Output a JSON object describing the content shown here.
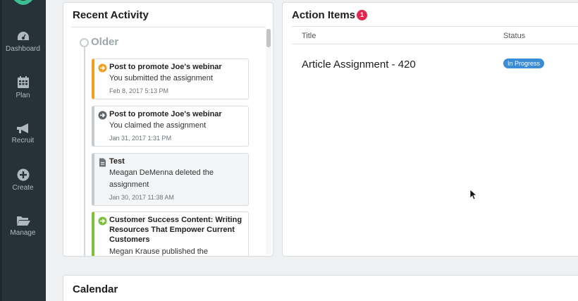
{
  "sidebar": {
    "items": [
      {
        "label": "Dashboard",
        "icon": "dashboard-icon"
      },
      {
        "label": "Plan",
        "icon": "calendar-icon"
      },
      {
        "label": "Recruit",
        "icon": "megaphone-icon"
      },
      {
        "label": "Create",
        "icon": "plus-circle-icon"
      },
      {
        "label": "Manage",
        "icon": "folder-icon"
      }
    ]
  },
  "recent_activity": {
    "title": "Recent Activity",
    "group_label": "Older",
    "items": [
      {
        "title": "Post to promote Joe's webinar",
        "body": "You submitted the assignment",
        "time": "Feb 8, 2017 5:13 PM",
        "icon": "arrow-circle-icon",
        "color": "#f0a020"
      },
      {
        "title": "Post to promote Joe's webinar",
        "body": "You claimed the assignment",
        "time": "Jan 31, 2017 1:31 PM",
        "icon": "arrow-circle-icon",
        "color": "#c5cace"
      },
      {
        "title": "Test",
        "body": "Meagan DeMenna deleted the assignment",
        "time": "Jan 30, 2017 11:38 AM",
        "icon": "document-icon",
        "color": "#c5cace"
      },
      {
        "title": "Customer Success Content: Writing Resources That Empower Current Customers",
        "body": "Megan Krause published the",
        "time": "",
        "icon": "arrow-circle-icon",
        "color": "#7cc03b"
      }
    ]
  },
  "action_items": {
    "title": "Action Items",
    "badge_count": "1",
    "columns": {
      "title": "Title",
      "status": "Status"
    },
    "rows": [
      {
        "title": "Article Assignment - 420",
        "status": "In Progress"
      }
    ]
  },
  "calendar": {
    "title": "Calendar"
  }
}
